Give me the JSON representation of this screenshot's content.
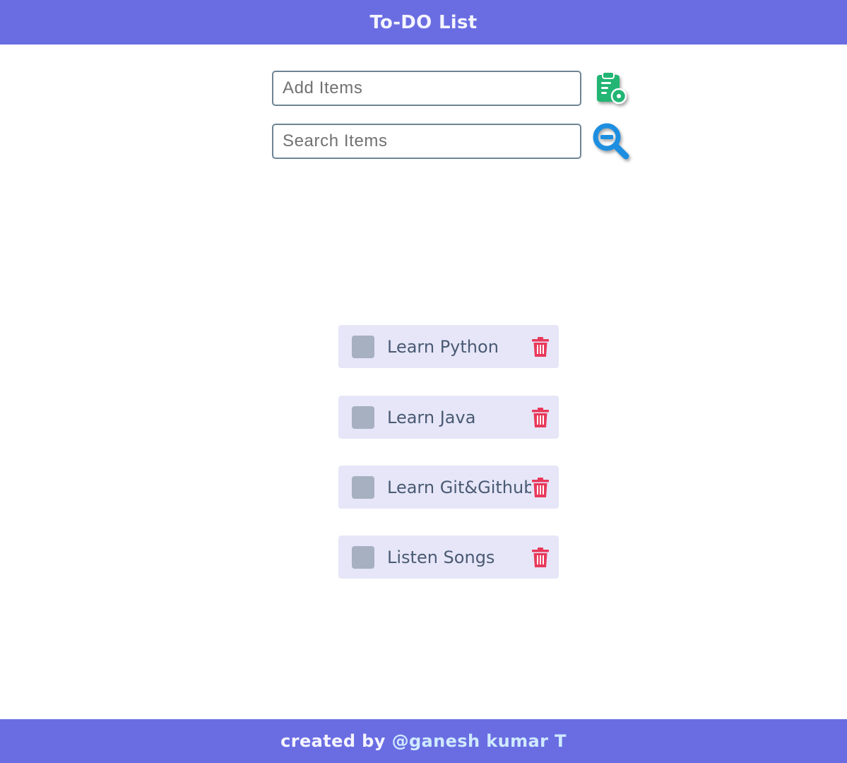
{
  "header": {
    "title": "To-DO List"
  },
  "add": {
    "placeholder": "Add Items",
    "value": "",
    "icon": "clipboard-add-icon",
    "icon_color": "#22b573"
  },
  "search": {
    "placeholder": "Search Items",
    "value": "",
    "icon": "search-minus-icon",
    "icon_color": "#1e8fe0"
  },
  "items": [
    {
      "label": "Learn Python",
      "checked": false
    },
    {
      "label": "Learn Java",
      "checked": false
    },
    {
      "label": "Learn Git&Github",
      "checked": false
    },
    {
      "label": "Listen Songs",
      "checked": false
    }
  ],
  "footer": {
    "prefix": "created by",
    "author": "@ganesh kumar T"
  },
  "colors": {
    "bar": "#6a6de2",
    "item_bg": "#e6e6f8",
    "trash": "#e8385a",
    "checkbox": "#a6b0c0"
  }
}
